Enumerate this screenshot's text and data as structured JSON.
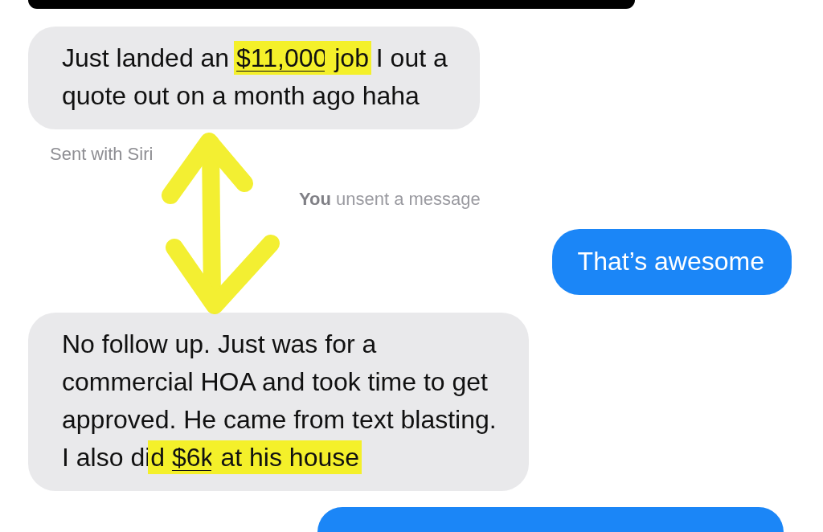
{
  "messages": [
    {
      "kind": "dark"
    },
    {
      "kind": "received",
      "lines": [
        [
          {
            "text": "Just landed an "
          },
          {
            "text": "$11,000",
            "link": true,
            "highlighted": true
          },
          {
            "text": " job",
            "highlighted": true
          },
          {
            "text": " I out a"
          }
        ],
        [
          {
            "text": "quote out on a month ago haha"
          }
        ]
      ]
    },
    {
      "kind": "caption",
      "text": "Sent with Siri"
    },
    {
      "kind": "status",
      "text": "**You** unsent a message"
    },
    {
      "kind": "sent",
      "lines": [
        [
          {
            "text": "That’s awesome"
          }
        ]
      ]
    },
    {
      "kind": "received",
      "lines": [
        [
          {
            "text": "No follow up. Just was for a"
          }
        ],
        [
          {
            "text": "commercial HOA and took time to get"
          }
        ],
        [
          {
            "text": "approved. He came from text blasting."
          }
        ],
        [
          {
            "text": "I also di"
          },
          {
            "text": "d ",
            "highlighted": true
          },
          {
            "text": "$6k",
            "link": true,
            "highlighted": true
          },
          {
            "text": " at his house",
            "highlighted": true
          }
        ]
      ]
    },
    {
      "kind": "sent"
    }
  ]
}
